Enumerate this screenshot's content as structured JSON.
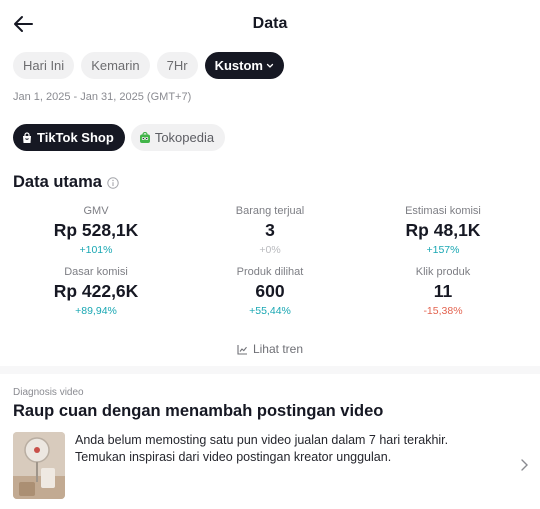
{
  "header": {
    "title": "Data",
    "back_icon": "arrow-left-icon"
  },
  "date_filters": [
    {
      "label": "Hari Ini",
      "active": false
    },
    {
      "label": "Kemarin",
      "active": false
    },
    {
      "label": "7Hr",
      "active": false
    },
    {
      "label": "Kustom",
      "active": true
    }
  ],
  "date_range": "Jan 1, 2025 - Jan 31, 2025 (GMT+7)",
  "shops": [
    {
      "label": "TikTok Shop",
      "icon": "shopping-bag-icon",
      "active": true
    },
    {
      "label": "Tokopedia",
      "icon": "tokopedia-icon",
      "active": false
    }
  ],
  "main": {
    "title": "Data utama",
    "metrics": [
      {
        "label": "GMV",
        "value": "Rp 528,1K",
        "change": "+101%",
        "trend": "pos"
      },
      {
        "label": "Barang terjual",
        "value": "3",
        "change": "+0%",
        "trend": "neu"
      },
      {
        "label": "Estimasi komisi",
        "value": "Rp 48,1K",
        "change": "+157%",
        "trend": "pos"
      },
      {
        "label": "Dasar komisi",
        "value": "Rp 422,6K",
        "change": "+89,94%",
        "trend": "pos"
      },
      {
        "label": "Produk dilihat",
        "value": "600",
        "change": "+55,44%",
        "trend": "pos"
      },
      {
        "label": "Klik produk",
        "value": "11",
        "change": "-15,38%",
        "trend": "neg"
      }
    ],
    "trend_link": "Lihat tren"
  },
  "diagnosis": {
    "label": "Diagnosis video",
    "title": "Raup cuan dengan menambah postingan video",
    "text": "Anda belum memosting satu pun video jualan dalam 7 hari terakhir. Temukan inspirasi dari video postingan kreator unggulan."
  },
  "colors": {
    "positive": "#19a7b3",
    "negative": "#e3634f",
    "neutral": "#b9babe",
    "active_chip": "#161823",
    "tokopedia": "#42b549"
  }
}
